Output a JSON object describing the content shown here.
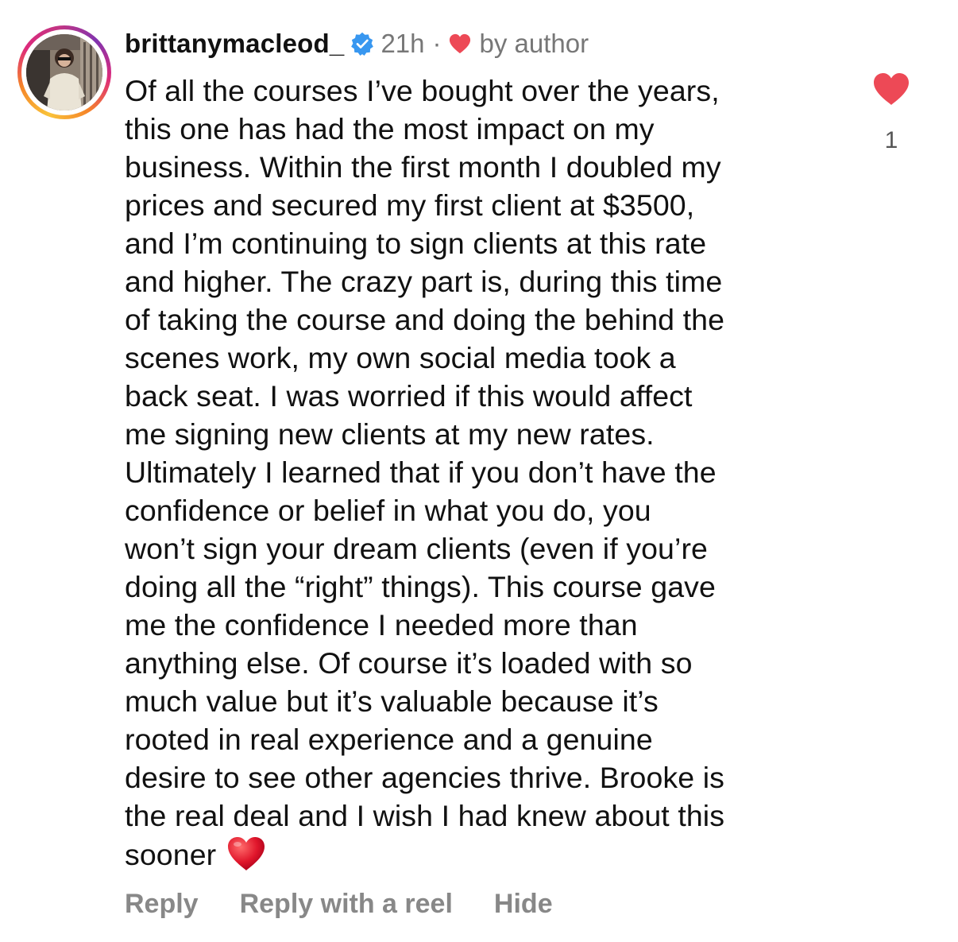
{
  "comment": {
    "username": "brittanymacleod_",
    "verified_icon": "verified-badge-icon",
    "time": "21h",
    "separator": "·",
    "liked_by_author_icon": "heart-icon",
    "liked_by_author_label": "by author",
    "body_lines": [
      "Of all the courses I’ve bought over the years,",
      "this one has had the most impact on my",
      "business. Within the first month I doubled my",
      "prices and secured my first client at $3500,",
      "and I’m continuing to sign clients at this rate",
      "and higher. The crazy part is, during this time",
      "of taking the course and doing the behind the",
      "scenes work, my own social media took a",
      "back seat. I was worried if this would affect",
      "me signing new clients at my new rates.",
      "Ultimately I learned that if you don’t have the",
      "confidence or belief in what you do, you",
      "won’t sign your dream clients (even if you’re",
      "doing all the “right” things). This course gave",
      "me the confidence I needed more than",
      "anything else. Of course it’s loaded with so",
      "much value but it’s valuable because it’s",
      "rooted in real experience and a genuine",
      "desire to see other agencies thrive. Brooke is",
      "the real deal and I wish I had knew about this",
      "sooner"
    ],
    "trailing_emoji": "red-heart-emoji",
    "like_icon": "heart-filled-icon",
    "like_count": "1",
    "actions": {
      "reply": "Reply",
      "reply_with_reel": "Reply with a reel",
      "hide": "Hide"
    }
  },
  "colors": {
    "heart_red": "#ed4956",
    "verified_blue": "#3897f0",
    "meta_gray": "#777777",
    "action_gray": "#888888",
    "text": "#111111"
  }
}
